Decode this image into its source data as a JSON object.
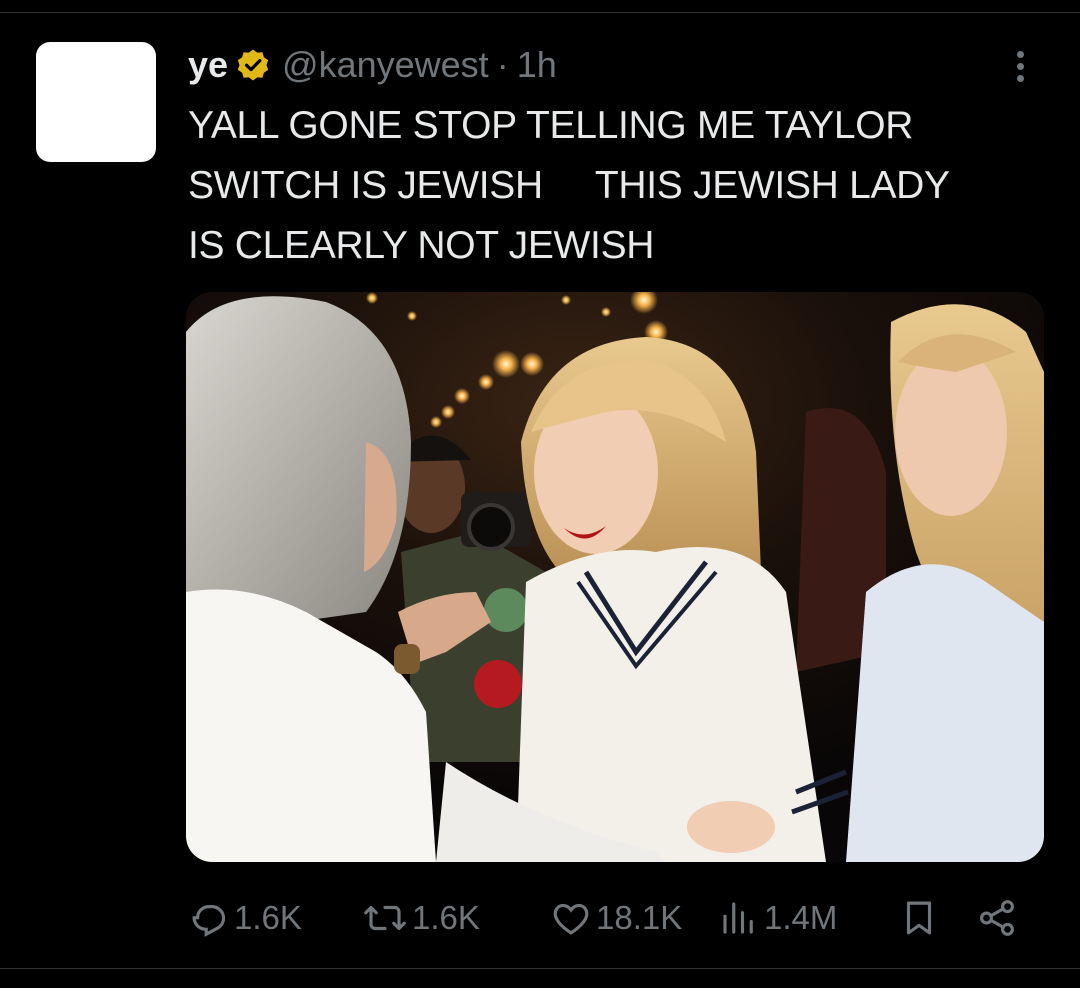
{
  "tweet": {
    "display_name": "ye",
    "handle": "@kanyewest",
    "separator": "·",
    "time": "1h",
    "verified_badge_icon": "verified-badge-icon",
    "text": "YALL GONE STOP TELLING ME TAYLOR\nSWITCH IS JEWISH     THIS JEWISH LADY\nIS CLEARLY NOT JEWISH",
    "media": "photo of people at a night event"
  },
  "actions": {
    "replies": "1.6K",
    "reposts": "1.6K",
    "likes": "18.1K",
    "views": "1.4M"
  },
  "icons": [
    "more-icon",
    "reply-icon",
    "repost-icon",
    "like-icon",
    "views-icon",
    "bookmark-icon",
    "share-icon"
  ],
  "colors": {
    "background": "#000000",
    "text": "#e7e9ea",
    "muted": "#71767b",
    "verified_gold": "#e2b719"
  }
}
